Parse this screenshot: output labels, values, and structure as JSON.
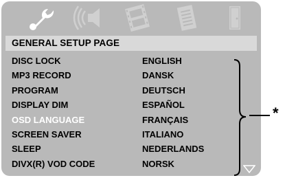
{
  "tabs": [
    {
      "name": "general-setup-tab",
      "icon": "wrench-icon"
    },
    {
      "name": "audio-setup-tab",
      "icon": "speaker-icon"
    },
    {
      "name": "video-setup-tab",
      "icon": "film-icon"
    },
    {
      "name": "preference-tab",
      "icon": "document-icon"
    },
    {
      "name": "exit-tab",
      "icon": "door-icon"
    }
  ],
  "header": {
    "title": "GENERAL SETUP PAGE"
  },
  "menu": {
    "items": [
      "DISC LOCK",
      "MP3 RECORD",
      "PROGRAM",
      "DISPLAY DIM",
      "OSD LANGUAGE",
      "SCREEN SAVER",
      "SLEEP",
      "DIVX(R) VOD CODE"
    ],
    "selected_index": 4
  },
  "options": {
    "items": [
      "ENGLISH",
      "DANSK",
      "DEUTSCH",
      "ESPAÑOL",
      "FRANÇAIS",
      "ITALIANO",
      "NEDERLANDS",
      "NORSK"
    ]
  },
  "annotation": {
    "marker": "*"
  },
  "colors": {
    "panel": "#b9b9b9",
    "header": "#d9d9d9",
    "selected_text": "#ffffff",
    "active_icon": "#ffffff",
    "inactive_icon": "#d0d0d0"
  }
}
